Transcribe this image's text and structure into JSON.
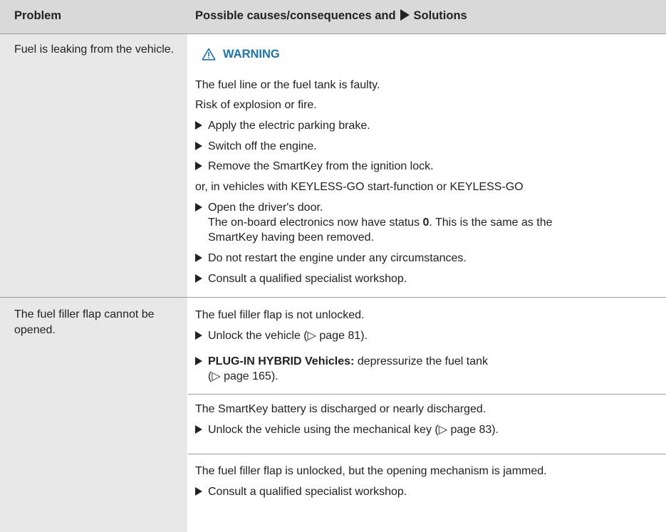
{
  "header": {
    "problem": "Problem",
    "solutions_prefix": "Possible causes/consequences and",
    "solutions_suffix": "Solutions"
  },
  "warning_label": "WARNING",
  "rows": {
    "r1": {
      "problem": "Fuel is leaking from the vehicle.",
      "cause": "The fuel line or the fuel tank is faulty.",
      "consequence": "Risk of explosion or fire.",
      "step1": "Apply the electric parking brake.",
      "step2": "Switch off the engine.",
      "step3": "Remove the SmartKey from the ignition lock.",
      "or_text": "or, in vehicles with KEYLESS-GO start-function or KEYLESS-GO",
      "step4": "Open the driver's door.",
      "step4_detail_a": "The on-board electronics now have status ",
      "step4_status": "0",
      "step4_detail_b": ". This is the same as the",
      "step4_detail_c": "SmartKey having been removed.",
      "step5": "Do not restart the engine under any circumstances.",
      "step6": "Consult a qualified specialist workshop."
    },
    "r2": {
      "problem": "The fuel filler flap cannot be opened.",
      "causeA": "The fuel filler flap is not unlocked.",
      "stepA1": "Unlock the vehicle (▷ page 81).",
      "stepA2_bold": "PLUG-IN HYBRID Vehicles:",
      "stepA2_rest": " depressurize the fuel tank",
      "stepA2_cont": "(▷ page 165).",
      "causeB": "The SmartKey battery is discharged or nearly discharged.",
      "stepB1": "Unlock the vehicle using the mechanical key (▷ page 83).",
      "causeC": "The fuel filler flap is unlocked, but the opening mechanism is jammed.",
      "stepC1": "Consult a qualified specialist workshop."
    }
  }
}
